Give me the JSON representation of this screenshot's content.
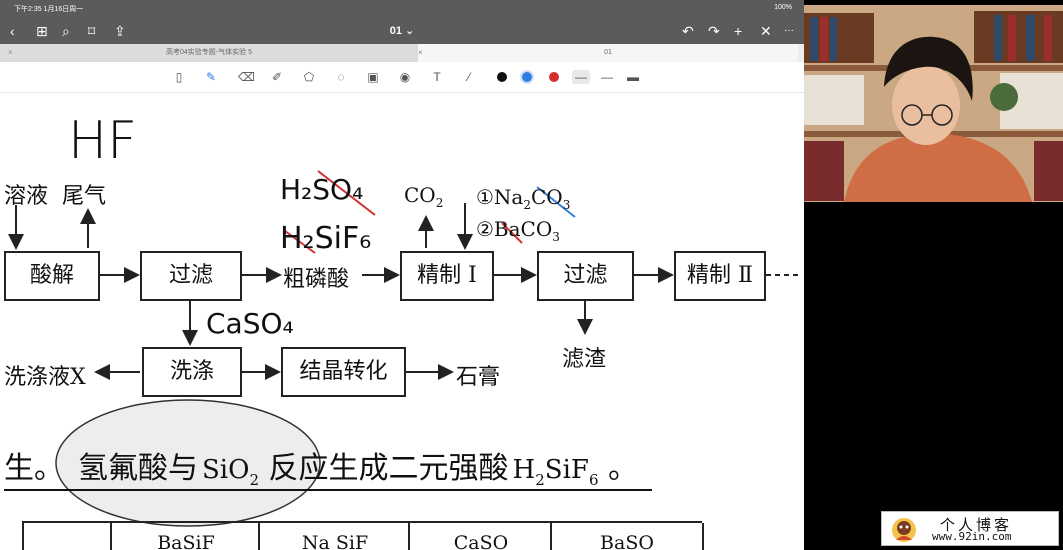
{
  "status": {
    "time": "下午2:35  1月16日周一",
    "battery": "100%"
  },
  "nav": {
    "title": "01 ⌄",
    "back": "‹",
    "grid": "⊞",
    "search": "⌕",
    "bookmark": "⌑",
    "share": "⇪",
    "undo": "↶",
    "redo": "↷",
    "add": "+",
    "close": "✕",
    "more": "···"
  },
  "tabs": {
    "left": "高考04实验专题-气体实验 5",
    "right": "01",
    "close": "×"
  },
  "diagram": {
    "top_left1": "溶液",
    "top_left2": "尾气",
    "acid": "酸解",
    "filter1": "过滤",
    "crude": "粗磷酸",
    "refine1": "精制 I",
    "filter2": "过滤",
    "refine2": "精制 Ⅱ",
    "wash": "洗涤",
    "wash_liquid": "洗涤液X",
    "crystal": "结晶转化",
    "gypsum": "石膏",
    "residue": "滤渣",
    "co2_main": "CO",
    "co2_sub": "2",
    "r1_a": "①Na",
    "r1_b": "2",
    "r1_c": "CO",
    "r1_d": "3",
    "r2_a": "②BaCO",
    "r2_b": "3"
  },
  "handwriting": {
    "hf": "HF",
    "h2so4": "H₂SO₄",
    "h2sif6": "H₂SiF₆",
    "caso4": "CaSO₄"
  },
  "sentence": {
    "lead": "生。",
    "circled": "氢氟酸与",
    "sio": "SiO",
    "sio_sub": "2",
    "rest1": " 反",
    "rest2": "应生成二元强酸",
    "h2": "H",
    "h2_sub": "2",
    "sif": "SiF",
    "sif_sub": "6",
    "end": " 。"
  },
  "table": {
    "col1": "",
    "col2": "BaSiF",
    "col3": "Na SiF",
    "col4": "CaSO",
    "col5": "BaSO"
  },
  "watermark": {
    "text": "个人博客",
    "url": "www.92in.com"
  },
  "colors": {
    "black": "#111111",
    "blue": "#2f7fe0",
    "red": "#d23030"
  }
}
